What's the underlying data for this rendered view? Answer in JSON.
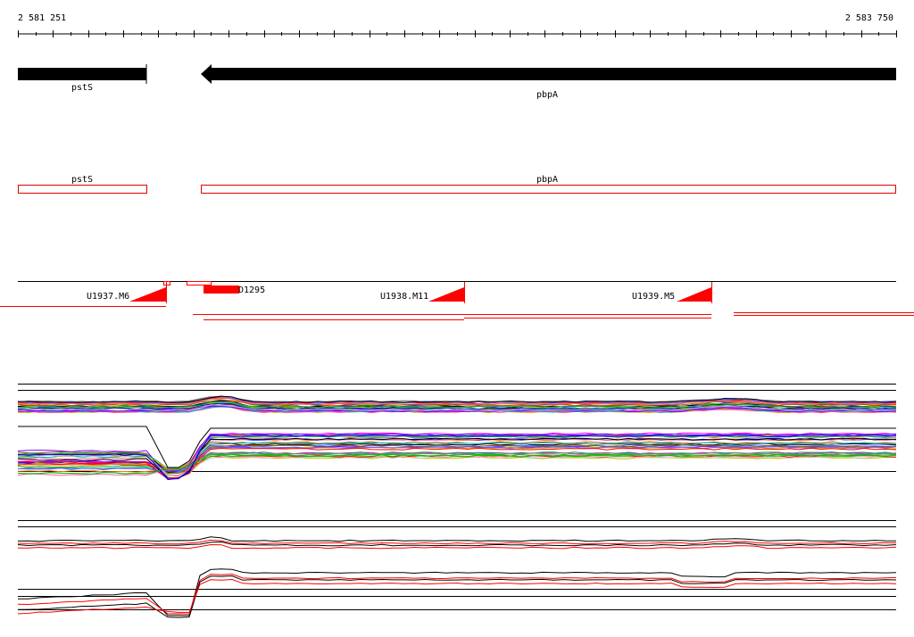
{
  "ruler": {
    "start_label": "2 581 251",
    "end_label": "2 583 750"
  },
  "gene_track": {
    "genes": [
      {
        "name": "pstS",
        "strand": "+"
      },
      {
        "name": "pbpA",
        "strand": "-"
      }
    ]
  },
  "annotation_track": {
    "features": [
      {
        "name": "pstS"
      },
      {
        "name": "pbpA"
      }
    ]
  },
  "segment_track": {
    "segments": [
      {
        "name": "U1937.M6"
      },
      {
        "name": "D1295"
      },
      {
        "name": "U1938.M11"
      },
      {
        "name": "U1939.M5"
      }
    ]
  },
  "colors": {
    "gene": "#000000",
    "annotation_outline": "#e00000",
    "segment": "#ff0000",
    "baseline": "#000000",
    "profile_palette": [
      "#ff0000",
      "#00c000",
      "#0000ff",
      "#ff00ff",
      "#00c0c0",
      "#c0c000",
      "#ff8000",
      "#8000ff",
      "#808080",
      "#a05000",
      "#00a060",
      "#ff60a0",
      "#6060ff",
      "#c0c0c0",
      "#000000"
    ]
  }
}
